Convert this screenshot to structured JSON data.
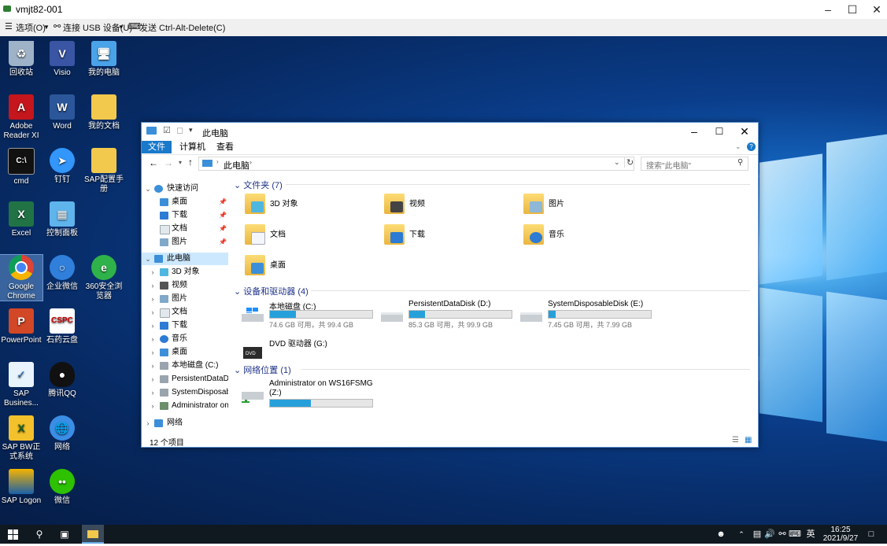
{
  "vm": {
    "title": "vmjt82-001",
    "menus": [
      "选项(O)",
      "连接 USB 设备(U)",
      "发送 Ctrl-Alt-Delete(C)"
    ]
  },
  "desktop_icons": [
    {
      "label": "回收站",
      "icon": "recycle-bin-icon"
    },
    {
      "label": "Visio",
      "icon": "visio-icon"
    },
    {
      "label": "我的电脑",
      "icon": "computer-icon"
    },
    {
      "label": "Adobe Reader XI",
      "icon": "adobe-reader-icon"
    },
    {
      "label": "Word",
      "icon": "word-icon"
    },
    {
      "label": "我的文档",
      "icon": "documents-folder-icon"
    },
    {
      "label": "cmd",
      "icon": "cmd-icon"
    },
    {
      "label": "钉钉",
      "icon": "dingtalk-icon"
    },
    {
      "label": "SAP配置手册",
      "icon": "folder-icon"
    },
    {
      "label": "Excel",
      "icon": "excel-icon"
    },
    {
      "label": "控制面板",
      "icon": "control-panel-icon"
    },
    {
      "label": "Google Chrome",
      "icon": "chrome-icon"
    },
    {
      "label": "企业微信",
      "icon": "wecom-icon"
    },
    {
      "label": "360安全浏览器",
      "icon": "360-browser-icon"
    },
    {
      "label": "PowerPoint",
      "icon": "powerpoint-icon"
    },
    {
      "label": "石药云盘",
      "icon": "cspc-cloud-icon"
    },
    {
      "label": "SAP Busines...",
      "icon": "sap-business-icon"
    },
    {
      "label": "腾讯QQ",
      "icon": "qq-icon"
    },
    {
      "label": "SAP BW正式系统",
      "icon": "sap-bw-icon"
    },
    {
      "label": "网络",
      "icon": "network-icon"
    },
    {
      "label": "SAP Logon",
      "icon": "sap-logon-icon"
    },
    {
      "label": "微信",
      "icon": "wechat-icon"
    }
  ],
  "explorer": {
    "title": "此电脑",
    "tabs": [
      "文件",
      "计算机",
      "查看"
    ],
    "address": "此电脑",
    "search_placeholder": "搜索\"此电脑\"",
    "nav": {
      "quick_access": "快速访问",
      "quick_items": [
        "桌面",
        "下载",
        "文档",
        "图片"
      ],
      "this_pc": "此电脑",
      "pc_items": [
        "3D 对象",
        "视频",
        "图片",
        "文档",
        "下载",
        "音乐",
        "桌面",
        "本地磁盘 (C:)",
        "PersistentDataDisk",
        "SystemDisposable",
        "Administrator on "
      ],
      "network": "网络"
    },
    "folders_header": "文件夹 (7)",
    "folders": [
      "3D 对象",
      "视频",
      "图片",
      "文档",
      "下载",
      "音乐",
      "桌面"
    ],
    "drives_header": "设备和驱动器 (4)",
    "drives": [
      {
        "name": "本地磁盘 (C:)",
        "space": "74.6 GB 可用，共 99.4 GB",
        "used_fraction": 0.25
      },
      {
        "name": "PersistentDataDisk (D:)",
        "space": "85.3 GB 可用，共 99.9 GB",
        "used_fraction": 0.15
      },
      {
        "name": "SystemDisposableDisk (E:)",
        "space": "7.45 GB 可用，共 7.99 GB",
        "used_fraction": 0.07
      }
    ],
    "dvd": "DVD 驱动器 (G:)",
    "network_header": "网络位置 (1)",
    "network_location": {
      "name_line1": "Administrator on WS16FSMG",
      "name_line2": "(Z:)",
      "used_fraction": 0.4
    },
    "status": "12 个项目"
  },
  "taskbar": {
    "ime": "英",
    "time": "16:25",
    "date": "2021/9/27"
  }
}
